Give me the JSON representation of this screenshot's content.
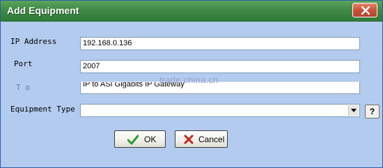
{
  "window": {
    "title": "Add Equipment",
    "close_icon": "close-icon"
  },
  "form": {
    "ip_label": "IP Address",
    "ip_value": "192.168.0.136",
    "port_label": "Port",
    "port_value": "2007",
    "third_label": "T p",
    "third_value": "IP to ASI Gigabits IP Gateway",
    "equipment_type_label": "Equipment Type",
    "equipment_type_value": "",
    "help_label": "?"
  },
  "buttons": {
    "ok_label": "OK",
    "ok_icon": "checkmark-icon",
    "cancel_label": "Cancel",
    "cancel_icon": "x-icon"
  },
  "watermark": "trade.china.cn",
  "colors": {
    "titlebar": "#3f8a45",
    "dialog_bg": "#b3cbee",
    "ok_icon": "#2e9a2e",
    "cancel_icon": "#c0281c"
  }
}
